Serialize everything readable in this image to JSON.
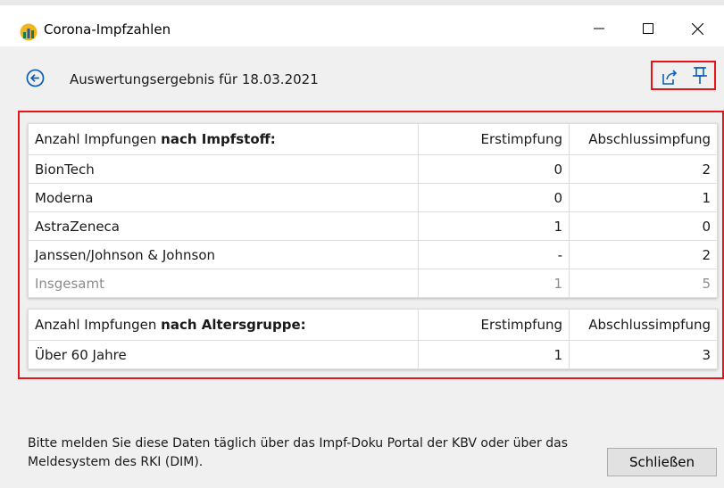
{
  "window": {
    "title": "Corona-Impfzahlen"
  },
  "header": {
    "title": "Auswertungsergebnis für 18.03.2021"
  },
  "vaccine_table": {
    "header_prefix": "Anzahl Impfungen ",
    "header_bold": "nach Impfstoff:",
    "col_first": "Erstimpfung",
    "col_final": "Abschlussimpfung",
    "rows": [
      {
        "name": "BionTech",
        "first": "0",
        "final": "2"
      },
      {
        "name": "Moderna",
        "first": "0",
        "final": "1"
      },
      {
        "name": "AstraZeneca",
        "first": "1",
        "final": "0"
      },
      {
        "name": "Janssen/Johnson & Johnson",
        "first": "-",
        "final": "2"
      }
    ],
    "total": {
      "name": "Insgesamt",
      "first": "1",
      "final": "5"
    }
  },
  "age_table": {
    "header_prefix": "Anzahl Impfungen ",
    "header_bold": "nach Altersgruppe:",
    "col_first": "Erstimpfung",
    "col_final": "Abschlussimpfung",
    "rows": [
      {
        "name": "Über 60 Jahre",
        "first": "1",
        "final": "3"
      }
    ]
  },
  "footer": {
    "notice": "Bitte melden Sie diese Daten täglich über das Impf-Doku Portal der KBV oder über das Meldesystem des RKI (DIM).",
    "close_label": "Schließen"
  },
  "colors": {
    "accent": "#0a5fb4",
    "highlight_border": "#e8131b"
  }
}
